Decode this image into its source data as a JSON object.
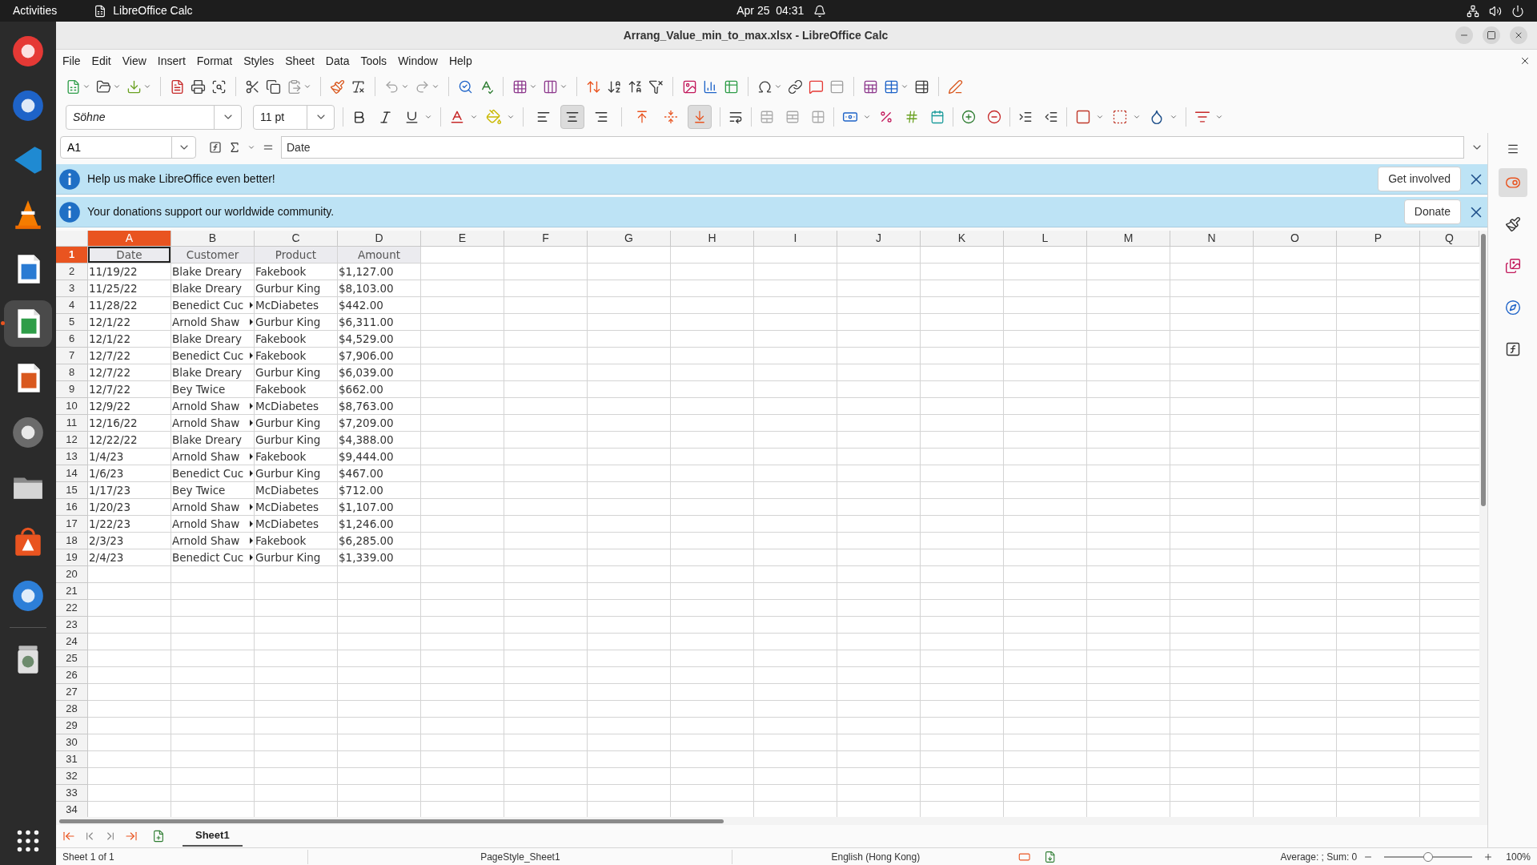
{
  "top_bar": {
    "activities": "Activities",
    "app_name": "LibreOffice Calc",
    "clock": "Apr 25  04:31"
  },
  "dock": [
    {
      "selected": false
    },
    {
      "selected": false
    },
    {
      "selected": false
    },
    {
      "selected": false
    },
    {
      "selected": false
    },
    {
      "selected": true
    },
    {
      "selected": false
    },
    {
      "selected": false
    },
    {
      "selected": false
    },
    {
      "selected": false
    },
    {
      "selected": false
    },
    {
      "selected": false
    }
  ],
  "window": {
    "title": "Arrang_Value_min_to_max.xlsx - LibreOffice Calc"
  },
  "menu": [
    "File",
    "Edit",
    "View",
    "Insert",
    "Format",
    "Styles",
    "Sheet",
    "Data",
    "Tools",
    "Window",
    "Help"
  ],
  "format_toolbar": {
    "font_name": "Söhne",
    "font_size": "11 pt",
    "horizontal_align": [
      {
        "selected": false
      },
      {
        "selected": true
      },
      {
        "selected": false
      }
    ],
    "vertical_align": [
      {
        "selected": false
      },
      {
        "selected": false
      },
      {
        "selected": true
      }
    ]
  },
  "formula_bar": {
    "cell_reference": "A1",
    "formula": "Date"
  },
  "infobars": [
    {
      "message": "Help us make LibreOffice even better!",
      "button": "Get involved"
    },
    {
      "message": "Your donations support our worldwide community.",
      "button": "Donate"
    }
  ],
  "columns": [
    {
      "label": "A",
      "selected": true
    },
    {
      "label": "B",
      "selected": false
    },
    {
      "label": "C",
      "selected": false
    },
    {
      "label": "D",
      "selected": false
    },
    {
      "label": "E",
      "selected": false
    },
    {
      "label": "F",
      "selected": false
    },
    {
      "label": "G",
      "selected": false
    },
    {
      "label": "H",
      "selected": false
    },
    {
      "label": "I",
      "selected": false
    },
    {
      "label": "J",
      "selected": false
    },
    {
      "label": "K",
      "selected": false
    },
    {
      "label": "L",
      "selected": false
    },
    {
      "label": "M",
      "selected": false
    },
    {
      "label": "N",
      "selected": false
    },
    {
      "label": "O",
      "selected": false
    },
    {
      "label": "P",
      "selected": false
    },
    {
      "label": "Q",
      "selected": false
    }
  ],
  "rows": [
    {
      "number": "1",
      "selected": true,
      "kind": "header",
      "cells": [
        {
          "text": "Date",
          "clipped": false
        },
        {
          "text": "Customer",
          "clipped": false
        },
        {
          "text": "Product",
          "clipped": false
        },
        {
          "text": "Amount",
          "clipped": false
        }
      ]
    },
    {
      "number": "2",
      "selected": false,
      "kind": "data",
      "cells": [
        {
          "text": "11/19/22",
          "clipped": false
        },
        {
          "text": "Blake Dreary",
          "clipped": false
        },
        {
          "text": "Fakebook",
          "clipped": false
        },
        {
          "text": "$1,127.00",
          "clipped": false
        }
      ]
    },
    {
      "number": "3",
      "selected": false,
      "kind": "data",
      "cells": [
        {
          "text": "11/25/22",
          "clipped": false
        },
        {
          "text": "Blake Dreary",
          "clipped": false
        },
        {
          "text": "Gurbur King",
          "clipped": false
        },
        {
          "text": "$8,103.00",
          "clipped": false
        }
      ]
    },
    {
      "number": "4",
      "selected": false,
      "kind": "data",
      "cells": [
        {
          "text": "11/28/22",
          "clipped": false
        },
        {
          "text": "Benedict Cuc",
          "clipped": true
        },
        {
          "text": "McDiabetes",
          "clipped": false
        },
        {
          "text": "$442.00",
          "clipped": false
        }
      ]
    },
    {
      "number": "5",
      "selected": false,
      "kind": "data",
      "cells": [
        {
          "text": "12/1/22",
          "clipped": false
        },
        {
          "text": "Arnold Shaw",
          "clipped": true
        },
        {
          "text": "Gurbur King",
          "clipped": false
        },
        {
          "text": "$6,311.00",
          "clipped": false
        }
      ]
    },
    {
      "number": "6",
      "selected": false,
      "kind": "data",
      "cells": [
        {
          "text": "12/1/22",
          "clipped": false
        },
        {
          "text": "Blake Dreary",
          "clipped": false
        },
        {
          "text": "Fakebook",
          "clipped": false
        },
        {
          "text": "$4,529.00",
          "clipped": false
        }
      ]
    },
    {
      "number": "7",
      "selected": false,
      "kind": "data",
      "cells": [
        {
          "text": "12/7/22",
          "clipped": false
        },
        {
          "text": "Benedict Cuc",
          "clipped": true
        },
        {
          "text": "Fakebook",
          "clipped": false
        },
        {
          "text": "$7,906.00",
          "clipped": false
        }
      ]
    },
    {
      "number": "8",
      "selected": false,
      "kind": "data",
      "cells": [
        {
          "text": "12/7/22",
          "clipped": false
        },
        {
          "text": "Blake Dreary",
          "clipped": false
        },
        {
          "text": "Gurbur King",
          "clipped": false
        },
        {
          "text": "$6,039.00",
          "clipped": false
        }
      ]
    },
    {
      "number": "9",
      "selected": false,
      "kind": "data",
      "cells": [
        {
          "text": "12/7/22",
          "clipped": false
        },
        {
          "text": "Bey Twice",
          "clipped": false
        },
        {
          "text": "Fakebook",
          "clipped": false
        },
        {
          "text": "$662.00",
          "clipped": false
        }
      ]
    },
    {
      "number": "10",
      "selected": false,
      "kind": "data",
      "cells": [
        {
          "text": "12/9/22",
          "clipped": false
        },
        {
          "text": "Arnold Shaw",
          "clipped": true
        },
        {
          "text": "McDiabetes",
          "clipped": false
        },
        {
          "text": "$8,763.00",
          "clipped": false
        }
      ]
    },
    {
      "number": "11",
      "selected": false,
      "kind": "data",
      "cells": [
        {
          "text": "12/16/22",
          "clipped": false
        },
        {
          "text": "Arnold Shaw",
          "clipped": true
        },
        {
          "text": "Gurbur King",
          "clipped": false
        },
        {
          "text": "$7,209.00",
          "clipped": false
        }
      ]
    },
    {
      "number": "12",
      "selected": false,
      "kind": "data",
      "cells": [
        {
          "text": "12/22/22",
          "clipped": false
        },
        {
          "text": "Blake Dreary",
          "clipped": false
        },
        {
          "text": "Gurbur King",
          "clipped": false
        },
        {
          "text": "$4,388.00",
          "clipped": false
        }
      ]
    },
    {
      "number": "13",
      "selected": false,
      "kind": "data",
      "cells": [
        {
          "text": "1/4/23",
          "clipped": false
        },
        {
          "text": "Arnold Shaw",
          "clipped": true
        },
        {
          "text": "Fakebook",
          "clipped": false
        },
        {
          "text": "$9,444.00",
          "clipped": false
        }
      ]
    },
    {
      "number": "14",
      "selected": false,
      "kind": "data",
      "cells": [
        {
          "text": "1/6/23",
          "clipped": false
        },
        {
          "text": "Benedict Cuc",
          "clipped": true
        },
        {
          "text": "Gurbur King",
          "clipped": false
        },
        {
          "text": "$467.00",
          "clipped": false
        }
      ]
    },
    {
      "number": "15",
      "selected": false,
      "kind": "data",
      "cells": [
        {
          "text": "1/17/23",
          "clipped": false
        },
        {
          "text": "Bey Twice",
          "clipped": false
        },
        {
          "text": "McDiabetes",
          "clipped": false
        },
        {
          "text": "$712.00",
          "clipped": false
        }
      ]
    },
    {
      "number": "16",
      "selected": false,
      "kind": "data",
      "cells": [
        {
          "text": "1/20/23",
          "clipped": false
        },
        {
          "text": "Arnold Shaw",
          "clipped": true
        },
        {
          "text": "McDiabetes",
          "clipped": false
        },
        {
          "text": "$1,107.00",
          "clipped": false
        }
      ]
    },
    {
      "number": "17",
      "selected": false,
      "kind": "data",
      "cells": [
        {
          "text": "1/22/23",
          "clipped": false
        },
        {
          "text": "Arnold Shaw",
          "clipped": true
        },
        {
          "text": "McDiabetes",
          "clipped": false
        },
        {
          "text": "$1,246.00",
          "clipped": false
        }
      ]
    },
    {
      "number": "18",
      "selected": false,
      "kind": "data",
      "cells": [
        {
          "text": "2/3/23",
          "clipped": false
        },
        {
          "text": "Arnold Shaw",
          "clipped": true
        },
        {
          "text": "Fakebook",
          "clipped": false
        },
        {
          "text": "$6,285.00",
          "clipped": false
        }
      ]
    },
    {
      "number": "19",
      "selected": false,
      "kind": "data",
      "cells": [
        {
          "text": "2/4/23",
          "clipped": false
        },
        {
          "text": "Benedict Cuc",
          "clipped": true
        },
        {
          "text": "Gurbur King",
          "clipped": false
        },
        {
          "text": "$1,339.00",
          "clipped": false
        }
      ]
    },
    {
      "number": "20",
      "selected": false,
      "kind": "data"
    },
    {
      "number": "21",
      "selected": false,
      "kind": "data"
    },
    {
      "number": "22",
      "selected": false,
      "kind": "data"
    },
    {
      "number": "23",
      "selected": false,
      "kind": "data"
    },
    {
      "number": "24",
      "selected": false,
      "kind": "data"
    },
    {
      "number": "25",
      "selected": false,
      "kind": "data"
    },
    {
      "number": "26",
      "selected": false,
      "kind": "data"
    },
    {
      "number": "27",
      "selected": false,
      "kind": "data"
    },
    {
      "number": "28",
      "selected": false,
      "kind": "data"
    },
    {
      "number": "29",
      "selected": false,
      "kind": "data"
    },
    {
      "number": "30",
      "selected": false,
      "kind": "data"
    },
    {
      "number": "31",
      "selected": false,
      "kind": "data"
    },
    {
      "number": "32",
      "selected": false,
      "kind": "data"
    },
    {
      "number": "33",
      "selected": false,
      "kind": "data"
    },
    {
      "number": "34",
      "selected": false,
      "kind": "data"
    }
  ],
  "sidebar_tabs": [
    {
      "selected": true
    },
    {
      "selected": false
    },
    {
      "selected": false
    },
    {
      "selected": false
    },
    {
      "selected": false
    }
  ],
  "sheet_tabs": [
    {
      "label": "Sheet1",
      "selected": true
    }
  ],
  "status_bar": {
    "sheet": "Sheet 1 of 1",
    "page_style": "PageStyle_Sheet1",
    "language": "English (Hong Kong)",
    "summary": "Average: ; Sum: 0",
    "zoom": {
      "level": 0.5,
      "reading": "100%"
    }
  }
}
